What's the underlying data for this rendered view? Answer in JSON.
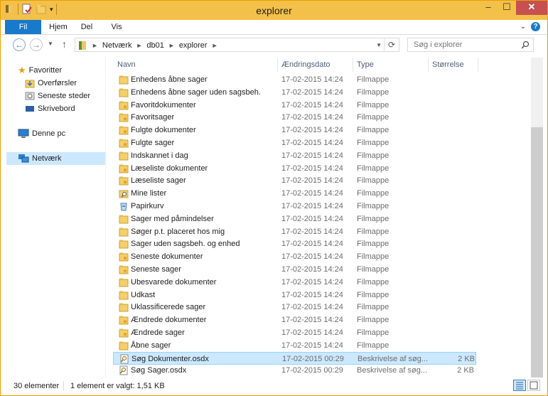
{
  "window": {
    "title": "explorer",
    "min_label": "–",
    "max_label": "☐",
    "close_label": "✕"
  },
  "ribbon": {
    "tabs": [
      "Fil",
      "Hjem",
      "Del",
      "Vis"
    ],
    "help_label": "?"
  },
  "address": {
    "crumbs": [
      "Netværk",
      "db01",
      "explorer"
    ]
  },
  "search": {
    "placeholder": "Søg i explorer"
  },
  "nav_pane": {
    "favorites": {
      "label": "Favoritter",
      "items": [
        "Overførsler",
        "Seneste steder",
        "Skrivebord"
      ]
    },
    "this_pc": "Denne pc",
    "network": "Netværk"
  },
  "columns": {
    "name": "Navn",
    "date": "Ændringsdato",
    "type": "Type",
    "size": "Størrelse"
  },
  "files": [
    {
      "name": "Enhedens åbne sager",
      "date": "17-02-2015 14:24",
      "type": "Filmappe",
      "size": "",
      "icon": "folder-icon"
    },
    {
      "name": "Enhedens åbne sager uden sagsbeh.",
      "date": "17-02-2015 14:24",
      "type": "Filmappe",
      "size": "",
      "icon": "folder-icon"
    },
    {
      "name": "Favoritdokumenter",
      "date": "17-02-2015 14:24",
      "type": "Filmappe",
      "size": "",
      "icon": "star-folder-icon"
    },
    {
      "name": "Favoritsager",
      "date": "17-02-2015 14:24",
      "type": "Filmappe",
      "size": "",
      "icon": "star-folder-icon"
    },
    {
      "name": "Fulgte dokumenter",
      "date": "17-02-2015 14:24",
      "type": "Filmappe",
      "size": "",
      "icon": "star-folder-icon"
    },
    {
      "name": "Fulgte sager",
      "date": "17-02-2015 14:24",
      "type": "Filmappe",
      "size": "",
      "icon": "star-folder-icon"
    },
    {
      "name": "Indskannet i dag",
      "date": "17-02-2015 14:24",
      "type": "Filmappe",
      "size": "",
      "icon": "folder-icon"
    },
    {
      "name": "Læseliste dokumenter",
      "date": "17-02-2015 14:24",
      "type": "Filmappe",
      "size": "",
      "icon": "star-folder-icon"
    },
    {
      "name": "Læseliste sager",
      "date": "17-02-2015 14:24",
      "type": "Filmappe",
      "size": "",
      "icon": "star-folder-icon"
    },
    {
      "name": "Mine lister",
      "date": "17-02-2015 14:24",
      "type": "Filmappe",
      "size": "",
      "icon": "search-folder-icon"
    },
    {
      "name": "Papirkurv",
      "date": "17-02-2015 14:24",
      "type": "Filmappe",
      "size": "",
      "icon": "recycle-bin-icon"
    },
    {
      "name": "Sager med påmindelser",
      "date": "17-02-2015 14:24",
      "type": "Filmappe",
      "size": "",
      "icon": "folder-icon"
    },
    {
      "name": "Søger p.t. placeret hos mig",
      "date": "17-02-2015 14:24",
      "type": "Filmappe",
      "size": "",
      "icon": "folder-icon"
    },
    {
      "name": "Sager uden sagsbeh. og enhed",
      "date": "17-02-2015 14:24",
      "type": "Filmappe",
      "size": "",
      "icon": "folder-icon"
    },
    {
      "name": "Seneste dokumenter",
      "date": "17-02-2015 14:24",
      "type": "Filmappe",
      "size": "",
      "icon": "star-folder-icon"
    },
    {
      "name": "Seneste sager",
      "date": "17-02-2015 14:24",
      "type": "Filmappe",
      "size": "",
      "icon": "star-folder-icon"
    },
    {
      "name": "Ubesvarede dokumenter",
      "date": "17-02-2015 14:24",
      "type": "Filmappe",
      "size": "",
      "icon": "folder-icon"
    },
    {
      "name": "Udkast",
      "date": "17-02-2015 14:24",
      "type": "Filmappe",
      "size": "",
      "icon": "folder-icon"
    },
    {
      "name": "Uklassificerede sager",
      "date": "17-02-2015 14:24",
      "type": "Filmappe",
      "size": "",
      "icon": "folder-icon"
    },
    {
      "name": "Ændrede dokumenter",
      "date": "17-02-2015 14:24",
      "type": "Filmappe",
      "size": "",
      "icon": "star-folder-icon"
    },
    {
      "name": "Ændrede sager",
      "date": "17-02-2015 14:24",
      "type": "Filmappe",
      "size": "",
      "icon": "star-folder-icon"
    },
    {
      "name": "Åbne sager",
      "date": "17-02-2015 14:24",
      "type": "Filmappe",
      "size": "",
      "icon": "folder-icon"
    },
    {
      "name": "Søg Dokumenter.osdx",
      "date": "17-02-2015 00:29",
      "type": "Beskrivelse af søg...",
      "size": "2 KB",
      "icon": "search-file-icon",
      "selected": true
    },
    {
      "name": "Søg Sager.osdx",
      "date": "17-02-2015 00:29",
      "type": "Beskrivelse af søg...",
      "size": "2 KB",
      "icon": "search-file-icon"
    }
  ],
  "status": {
    "count": "30 elementer",
    "selection": "1 element er valgt: 1,51 KB"
  },
  "colors": {
    "titlebar": "#f3c04a",
    "accent": "#1979ca",
    "selection": "#cce8ff",
    "folder": "#f5cf6a"
  }
}
